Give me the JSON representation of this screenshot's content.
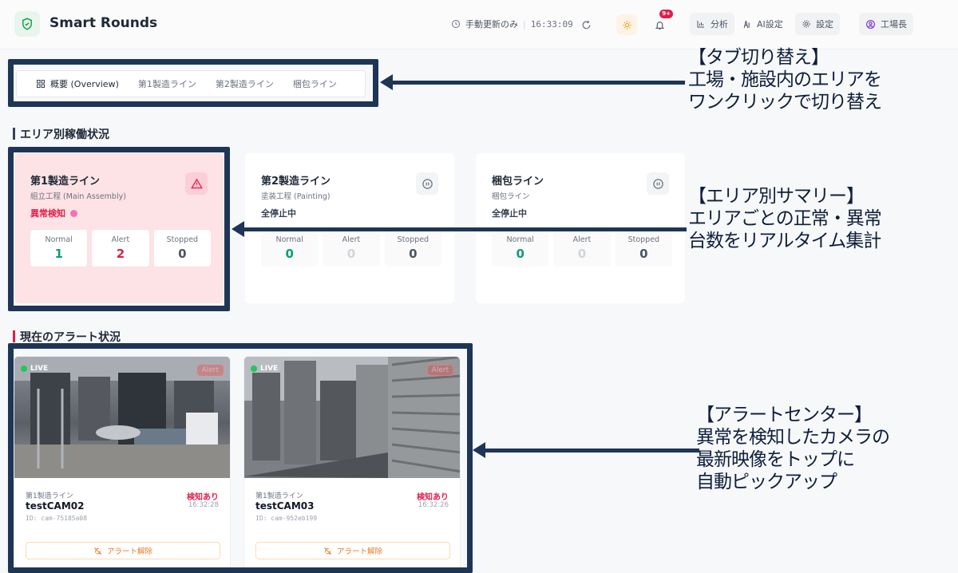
{
  "header": {
    "app_title": "Smart Rounds",
    "refresh_mode": "手動更新のみ",
    "time": "16:33:09",
    "notification_badge": "9+",
    "analysis_label": "分析",
    "ai_settings_label": "AI設定",
    "settings_label": "設定",
    "user_label": "工場長"
  },
  "tabs": [
    {
      "label": "概要 (Overview)"
    },
    {
      "label": "第1製造ライン"
    },
    {
      "label": "第2製造ライン"
    },
    {
      "label": "梱包ライン"
    }
  ],
  "sections": {
    "area_status": "エリア別稼働状況",
    "alert_status": "現在のアラート状況"
  },
  "areas": [
    {
      "name": "第1製造ライン",
      "sub": "組立工程 (Main Assembly)",
      "status": "異常検知",
      "normal_label": "Normal",
      "normal": "1",
      "alert_label": "Alert",
      "alert": "2",
      "stopped_label": "Stopped",
      "stopped": "0"
    },
    {
      "name": "第2製造ライン",
      "sub": "塗装工程 (Painting)",
      "status": "全停止中",
      "normal_label": "Normal",
      "normal": "0",
      "alert_label": "Alert",
      "alert": "0",
      "stopped_label": "Stopped",
      "stopped": "0"
    },
    {
      "name": "梱包ライン",
      "sub": "梱包ライン",
      "status": "全停止中",
      "normal_label": "Normal",
      "normal": "0",
      "alert_label": "Alert",
      "alert": "0",
      "stopped_label": "Stopped",
      "stopped": "0"
    }
  ],
  "cameras": [
    {
      "live": "LIVE",
      "chip": "Alert",
      "area": "第1製造ライン",
      "name": "testCAM02",
      "id": "ID: cam-75185a08",
      "detect": "検知あり",
      "time": "16:32:28",
      "dismiss": "アラート解除"
    },
    {
      "live": "LIVE",
      "chip": "Alert",
      "area": "第1製造ライン",
      "name": "testCAM03",
      "id": "ID: cam-952eb199",
      "detect": "検知あり",
      "time": "16:32:26",
      "dismiss": "アラート解除"
    }
  ],
  "annotations": {
    "tab_title": "【タブ切り替え】",
    "tab_line1": "工場・施設内のエリアを",
    "tab_line2": "ワンクリックで切り替え",
    "area_title": "【エリア別サマリー】",
    "area_line1": "エリアごとの正常・異常",
    "area_line2": "台数をリアルタイム集計",
    "alert_title": "【アラートセンター】",
    "alert_line1": "異常を検知したカメラの",
    "alert_line2": "最新映像をトップに",
    "alert_line3": "自動ピックアップ"
  },
  "colors": {
    "annotation_navy": "#1e3556",
    "alert_red": "#e11d48",
    "normal_green": "#0f9d76",
    "alert_card_bg": "#fde2e6"
  }
}
